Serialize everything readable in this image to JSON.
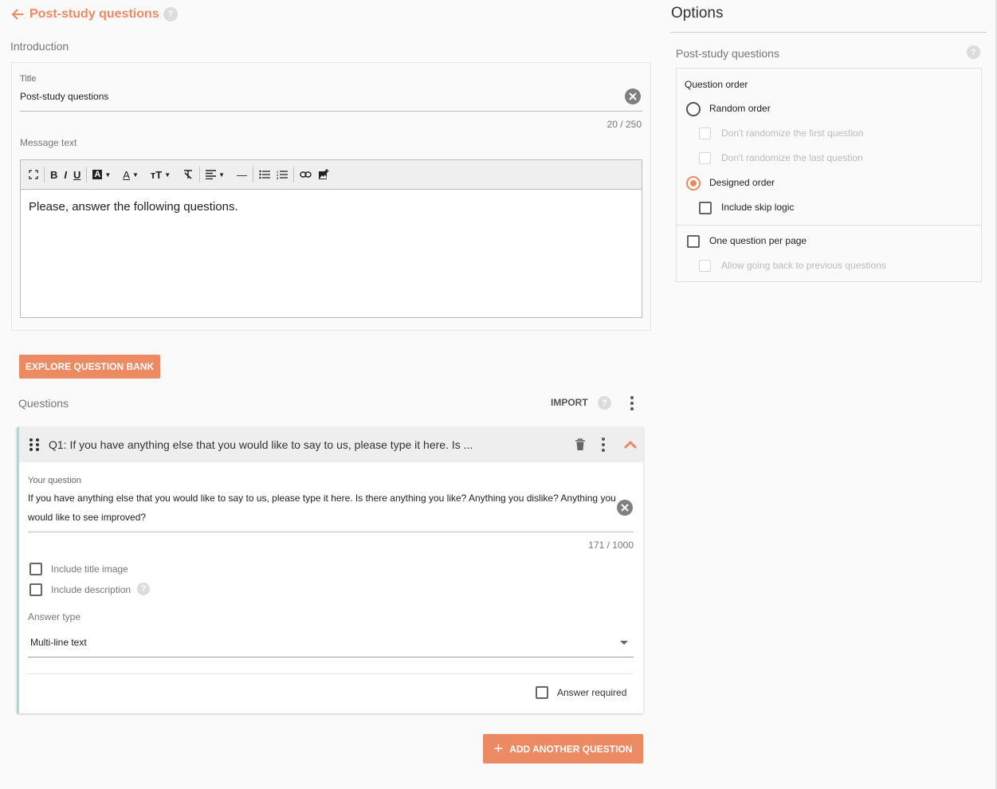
{
  "header": {
    "title": "Post-study questions",
    "help": "?"
  },
  "introduction": {
    "section_label": "Introduction",
    "title_label": "Title",
    "title_value": "Post-study questions",
    "title_counter": "20 / 250",
    "message_label": "Message text",
    "message_body": "Please, answer the following questions.",
    "toolbar": {
      "fullscreen": "fullscreen-icon",
      "bold": "B",
      "italic": "I",
      "underline": "U",
      "highlight": "A",
      "font_color": "A",
      "font_size": "тT",
      "clear_format": "clear-format-icon",
      "align": "align-icon",
      "hr": "—",
      "bullet_list": "bullet-list-icon",
      "numbered_list": "numbered-list-icon",
      "link": "link-icon",
      "image": "image-icon"
    }
  },
  "question_bank_button": "EXPLORE QUESTION BANK",
  "questions": {
    "section_label": "Questions",
    "import_label": "IMPORT",
    "items": [
      {
        "header_title": "Q1: If you have anything else that you would like to say to us, please type it here. Is ...",
        "your_question_label": "Your question",
        "question_line1": "If you have anything else that you would like to say to us, please type it here. Is there anything you like? Anything you dislike? Anything you",
        "question_line2": "would like to see improved?",
        "counter": "171 / 1000",
        "include_title_image": "Include title image",
        "include_description": "Include description",
        "answer_type_label": "Answer type",
        "answer_type_value": "Multi-line text",
        "answer_required": "Answer required"
      }
    ]
  },
  "add_question_button": "ADD ANOTHER QUESTION",
  "options": {
    "title": "Options",
    "section_label": "Post-study questions",
    "question_order_label": "Question order",
    "random_order": "Random order",
    "dont_randomize_first": "Don't randomize the first question",
    "dont_randomize_last": "Don't randomize the last question",
    "designed_order": "Designed order",
    "include_skip_logic": "Include skip logic",
    "one_per_page": "One question per page",
    "allow_going_back": "Allow going back to previous questions",
    "selected_order": "designed"
  },
  "colors": {
    "accent": "#ec8b63",
    "card_accent": "#a6dcd7"
  }
}
